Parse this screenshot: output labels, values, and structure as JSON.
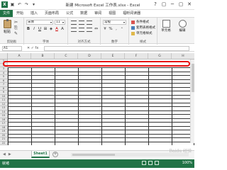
{
  "window": {
    "title": "新建 Microsoft Excel 工作表.xlsx - Excel",
    "logo": "X",
    "controls": [
      "?",
      "▢",
      "─",
      "▢",
      "✕"
    ]
  },
  "quick_access": [
    "save-icon",
    "undo-icon",
    "redo-icon",
    "customize-icon"
  ],
  "tabs": [
    "文件",
    "开始",
    "插入",
    "页面布局",
    "公式",
    "数据",
    "审阅",
    "视图",
    "福昕阅读器"
  ],
  "ribbon": {
    "paste_label": "粘贴",
    "clipboard_label": "剪贴板",
    "font_name": "宋体",
    "font_size": "11",
    "font_label": "字体",
    "align_label": "对齐方式",
    "number_format": "常规",
    "number_label": "数字",
    "conditional_format": "条件格式",
    "table_format": "套用表格格式",
    "cell_styles": "单元格样式",
    "styles_label": "样式",
    "cells_btn": "单元格",
    "edit_btn": "编辑"
  },
  "formula_bar": {
    "name_box": "A1",
    "fx": "✕ ✓ fx",
    "value": ""
  },
  "grid": {
    "columns": [
      "A",
      "B",
      "C",
      "D",
      "E",
      "F",
      "G",
      "H"
    ],
    "rows": [
      "1",
      "2",
      "3",
      "4",
      "5",
      "6",
      "7",
      "8",
      "9",
      "10",
      "11",
      "12",
      "13",
      "14",
      "15",
      "16",
      "17",
      "18",
      "19",
      "20",
      "21",
      "22"
    ]
  },
  "sheets": {
    "active": "Sheet1",
    "add": "+"
  },
  "status": {
    "ready": "就绪",
    "zoom": "100%"
  },
  "watermark": "Baidu 经验",
  "colors": {
    "excel_green": "#217346",
    "highlight": "#e81010"
  }
}
